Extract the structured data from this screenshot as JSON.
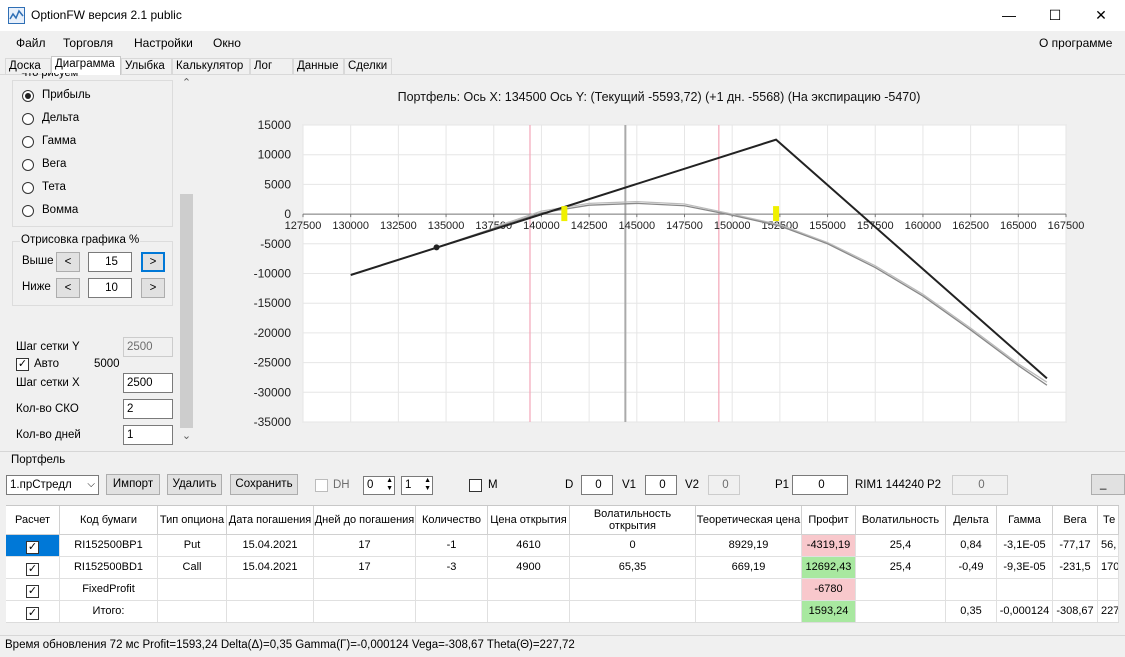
{
  "window": {
    "title": "OptionFW версия 2.1 public",
    "minimize": "—",
    "maximize": "☐",
    "close": "✕"
  },
  "menu": {
    "items": [
      "Файл",
      "Торговля",
      "Настройки",
      "Окно"
    ],
    "about": "О программе"
  },
  "tabs": [
    "Доска",
    "Диаграмма",
    "Улыбка",
    "Калькулятор",
    "Лог",
    "Данные",
    "Сделки"
  ],
  "active_tab": "Диаграмма",
  "left": {
    "group_title": "Что рисуем",
    "radios": [
      "Прибыль",
      "Дельта",
      "Гамма",
      "Вега",
      "Тета",
      "Вомма"
    ],
    "selected_radio": "Прибыль",
    "draw_group": "Отрисовка графика %",
    "upper_label": "Выше",
    "upper_value": "15",
    "lower_label": "Ниже",
    "lower_value": "10",
    "prev": "<",
    "next": ">",
    "grid_y_label": "Шаг сетки Y",
    "grid_y_value": "2500",
    "auto_label": "Авто",
    "auto_value": "5000",
    "auto_checked": "✓",
    "grid_x_label": "Шаг сетки X",
    "grid_x_value": "2500",
    "sko_label": "Кол-во СКО",
    "sko_value": "2",
    "days_label": "Кол-во дней",
    "days_value": "1",
    "scroll_up": "⌃",
    "scroll_down": "⌄"
  },
  "chart_data": {
    "type": "line",
    "title": "Портфель: Ось X: 134500 Ось Y:  (Текущий -5593,72)  (+1 дн. -5568)  (На экспирацию -5470)",
    "xlim": [
      127500,
      167500
    ],
    "ylim": [
      -35000,
      15000
    ],
    "x_ticks": [
      "127500",
      "130000",
      "132500",
      "135000",
      "137500",
      "140000",
      "142500",
      "145000",
      "147500",
      "150000",
      "152500",
      "155000",
      "157500",
      "160000",
      "162500",
      "165000",
      "167500"
    ],
    "y_ticks": [
      "15000",
      "10000",
      "5000",
      "0",
      "-5000",
      "-10000",
      "-15000",
      "-20000",
      "-25000",
      "-30000",
      "-35000"
    ],
    "grid": true,
    "vertical_lines": [
      {
        "x": 139400,
        "color": "#f4a6b8"
      },
      {
        "x": 144400,
        "color": "#aaaaaa"
      },
      {
        "x": 149300,
        "color": "#f4a6b8"
      }
    ],
    "markers": [
      {
        "x": 141200,
        "y": 0,
        "color": "#f0f000"
      },
      {
        "x": 152300,
        "y": 0,
        "color": "#f0f000"
      }
    ],
    "current_point": {
      "x": 134500,
      "y": -5594
    },
    "series": [
      {
        "values_x": [
          130000,
          152300,
          166500
        ],
        "values_y": [
          -10250,
          12540,
          -27650
        ],
        "color": "#222222"
      },
      {
        "values_x": [
          134500,
          137500,
          140000,
          142500,
          145000,
          147500,
          150000,
          152500,
          155000,
          157500,
          160000,
          162500,
          165000,
          166500
        ],
        "values_y": [
          -5594,
          -2400,
          200,
          1500,
          1800,
          1400,
          -200,
          -2000,
          -5000,
          -9000,
          -13800,
          -19500,
          -25500,
          -28800
        ],
        "color": "#888888"
      },
      {
        "values_x": [
          137500,
          140000,
          142500,
          145000,
          147500,
          150000,
          152500,
          155000,
          157500,
          160000,
          162500,
          165000,
          166500
        ],
        "values_y": [
          -2200,
          500,
          1800,
          2100,
          1700,
          0,
          -1800,
          -4800,
          -8700,
          -13500,
          -19200,
          -25200,
          -28300
        ],
        "color": "#bbbbbb"
      }
    ]
  },
  "portfolio": {
    "label": "Портфель",
    "combo": "1.прСтредл",
    "import": "Импорт",
    "delete": "Удалить",
    "save": "Сохранить",
    "dh": "DH",
    "spin1": "0",
    "spin2": "1",
    "m": "M",
    "d_label": "D",
    "d_value": "0",
    "v1_label": "V1",
    "v1_value": "0",
    "v2_label": "V2",
    "v2_value": "0",
    "p1_label": "P1",
    "p1_value": "0",
    "rim": "RIM1 144240",
    "p2_label": "P2",
    "p2_value": "0",
    "small_btn": "_"
  },
  "table": {
    "headers": [
      "Расчет",
      "Код бумаги",
      "Тип опциона",
      "Дата погашения",
      "Дней до погашения",
      "Количество",
      "Цена открытия",
      "Волатильность открытия",
      "Теоретическая цена",
      "Профит",
      "Волатильность",
      "Дельта",
      "Гамма",
      "Вега",
      "Те"
    ],
    "rows": [
      {
        "check": "✓",
        "code": "RI152500BP1",
        "type": "Put",
        "date": "15.04.2021",
        "days": "17",
        "qty": "-1",
        "price": "4610",
        "vol_open": "0",
        "theo": "8929,19",
        "profit": "-4319,19",
        "vol": "25,4",
        "delta": "0,84",
        "gamma": "-3,1E-05",
        "vega": "-77,17",
        "theta": "56,"
      },
      {
        "check": "✓",
        "code": "RI152500BD1",
        "type": "Call",
        "date": "15.04.2021",
        "days": "17",
        "qty": "-3",
        "price": "4900",
        "vol_open": "65,35",
        "theo": "669,19",
        "profit": "12692,43",
        "vol": "25,4",
        "delta": "-0,49",
        "gamma": "-9,3E-05",
        "vega": "-231,5",
        "theta": "170"
      },
      {
        "check": "✓",
        "code": "FixedProfit",
        "type": "",
        "date": "",
        "days": "",
        "qty": "",
        "price": "",
        "vol_open": "",
        "theo": "",
        "profit": "-6780",
        "vol": "",
        "delta": "",
        "gamma": "",
        "vega": "",
        "theta": ""
      },
      {
        "check": "✓",
        "code": "Итого:",
        "type": "",
        "date": "",
        "days": "",
        "qty": "",
        "price": "",
        "vol_open": "",
        "theo": "",
        "profit": "1593,24",
        "vol": "",
        "delta": "0,35",
        "gamma": "-0,000124",
        "vega": "-308,67",
        "theta": "227"
      }
    ]
  },
  "colors": {
    "profit_neg": "#f8c8cc",
    "profit_pos": "#a8e8a0",
    "selected_cell": "#0078d7"
  },
  "status": "Время обновления 72 мс  Profit=1593,24 Delta(Δ)=0,35 Gamma(Γ)=-0,000124 Vega=-308,67 Theta(Θ)=227,72"
}
